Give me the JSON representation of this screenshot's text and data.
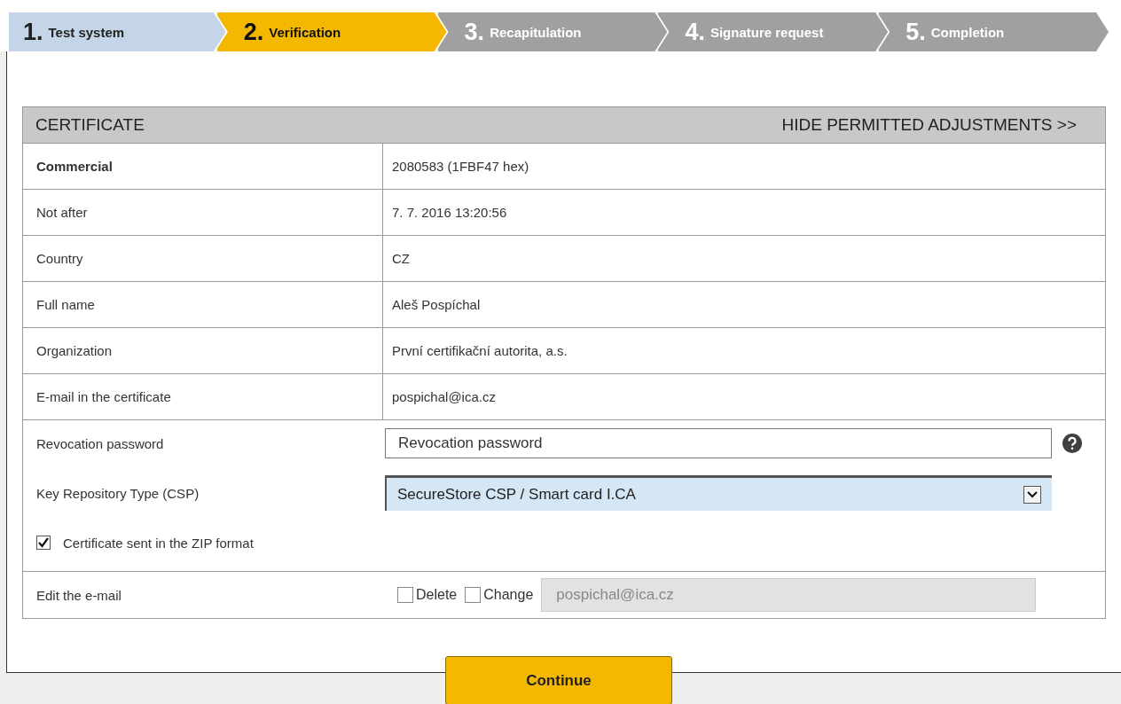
{
  "steps": [
    {
      "number": "1.",
      "label": "Test system",
      "done": true,
      "selected": false
    },
    {
      "number": "2.",
      "label": "Verification",
      "done": false,
      "selected": true
    },
    {
      "number": "3.",
      "label": "Recapitulation",
      "done": false,
      "selected": false
    },
    {
      "number": "4.",
      "label": "Signature request",
      "done": false,
      "selected": false
    },
    {
      "number": "5.",
      "label": "Completion",
      "done": false,
      "selected": false
    }
  ],
  "certificate": {
    "title": "CERTIFICATE",
    "toggle_link": "HIDE PERMITTED ADJUSTMENTS >>",
    "rows": [
      {
        "label": "Commercial",
        "value": "2080583 (1FBF47 hex)",
        "bold": true
      },
      {
        "label": "Not after",
        "value": "7. 7. 2016 13:20:56",
        "bold": false
      },
      {
        "label": "Country",
        "value": "CZ",
        "bold": false
      },
      {
        "label": "Full name",
        "value": "Aleš Pospíchal",
        "bold": false
      },
      {
        "label": "Organization",
        "value": "První certifikační autorita, a.s.",
        "bold": false
      },
      {
        "label": "E-mail in the certificate",
        "value": "pospichal@ica.cz",
        "bold": false
      }
    ]
  },
  "form": {
    "revocation_password": {
      "label": "Revocation password",
      "placeholder": "Revocation password"
    },
    "key_repository": {
      "label": "Key Repository Type (CSP)",
      "value": "SecureStore CSP / Smart card I.CA"
    },
    "zip_format": {
      "label": "Certificate sent in the ZIP format",
      "checked": true
    },
    "edit_email": {
      "label": "Edit the e-mail",
      "delete": {
        "label": "Delete",
        "checked": false
      },
      "change": {
        "label": "Change",
        "checked": false
      },
      "value": "pospichal@ica.cz",
      "disabled": true
    }
  },
  "continue_button": "Continue"
}
